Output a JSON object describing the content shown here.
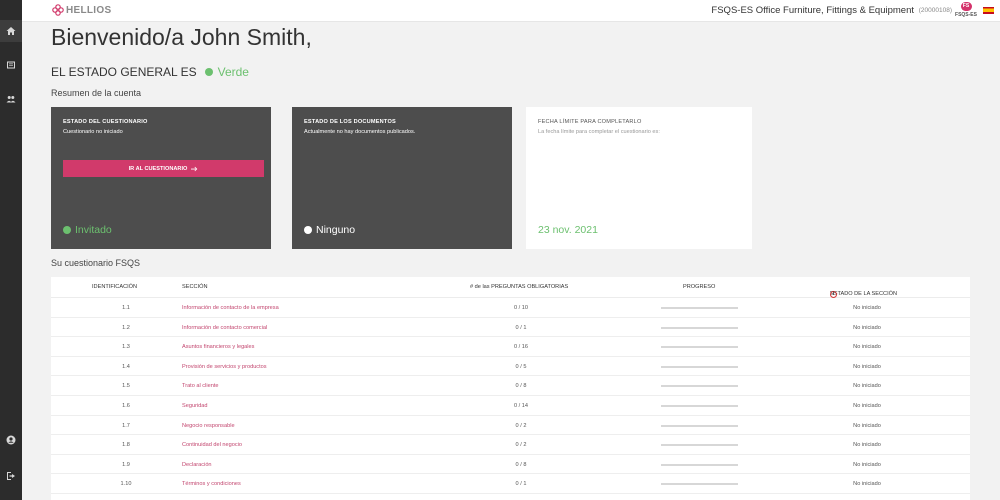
{
  "header": {
    "logo_text": "HELLIOS",
    "company_name": "FSQS-ES Office Furniture, Fittings & Equipment",
    "company_id": "(20000108)",
    "badge_label": "FSQS-ES",
    "badge_symbol": "FS"
  },
  "sidebar": {
    "items": [
      {
        "icon": "home-icon",
        "active": true
      },
      {
        "icon": "list-icon",
        "active": false
      },
      {
        "icon": "users-icon",
        "active": false
      }
    ],
    "bottom_items": [
      {
        "icon": "account-icon"
      },
      {
        "icon": "logout-icon"
      }
    ]
  },
  "welcome": "Bienvenido/a John Smith,",
  "overall_status": {
    "label": "EL ESTADO GENERAL ES",
    "value": "Verde",
    "color": "#6cc06f"
  },
  "account_summary_title": "Resumen de la cuenta",
  "cards": {
    "questionnaire": {
      "title": "ESTADO DEL CUESTIONARIO",
      "subtitle": "Cuestionario no iniciado",
      "button": "IR AL CUESTIONARIO",
      "status": "Invitado",
      "status_color": "#6cc06f"
    },
    "documents": {
      "title": "ESTADO DE LOS DOCUMENTOS",
      "subtitle": "Actualmente no hay documentos publicados.",
      "status": "Ninguno",
      "status_color": "#ffffff"
    },
    "deadline": {
      "title": "FECHA LÍMITE PARA COMPLETARLO",
      "subtitle": "La fecha límite para completar el cuestionario es:",
      "date": "23 nov. 2021",
      "date_color": "#6cc06f"
    }
  },
  "questionnaire_table": {
    "title": "Su cuestionario FSQS",
    "headers": {
      "id": "IDENTIFICACIÓN",
      "section": "SECCIÓN",
      "required": "# de las PREGUNTAS OBLIGATORIAS",
      "progress": "PROGRESO",
      "state": "ESTADO DE LA SECCIÓN"
    },
    "rows": [
      {
        "id": "1.1",
        "section": "Información de contacto de la empresa",
        "required": "0 / 10",
        "progress": 0,
        "state": "No iniciado"
      },
      {
        "id": "1.2",
        "section": "Información de contacto comercial",
        "required": "0 / 1",
        "progress": 0,
        "state": "No iniciado"
      },
      {
        "id": "1.3",
        "section": "Asuntos financieros y legales",
        "required": "0 / 16",
        "progress": 0,
        "state": "No iniciado"
      },
      {
        "id": "1.4",
        "section": "Provisión de servicios y productos",
        "required": "0 / 5",
        "progress": 0,
        "state": "No iniciado"
      },
      {
        "id": "1.5",
        "section": "Trato al cliente",
        "required": "0 / 8",
        "progress": 0,
        "state": "No iniciado"
      },
      {
        "id": "1.6",
        "section": "Seguridad",
        "required": "0 / 14",
        "progress": 0,
        "state": "No iniciado"
      },
      {
        "id": "1.7",
        "section": "Negocio responsable",
        "required": "0 / 2",
        "progress": 0,
        "state": "No iniciado"
      },
      {
        "id": "1.8",
        "section": "Continuidad del negocio",
        "required": "0 / 2",
        "progress": 0,
        "state": "No iniciado"
      },
      {
        "id": "1.9",
        "section": "Declaración",
        "required": "0 / 8",
        "progress": 0,
        "state": "No iniciado"
      },
      {
        "id": "1.10",
        "section": "Términos y condiciones",
        "required": "0 / 1",
        "progress": 0,
        "state": "No iniciado"
      }
    ]
  }
}
